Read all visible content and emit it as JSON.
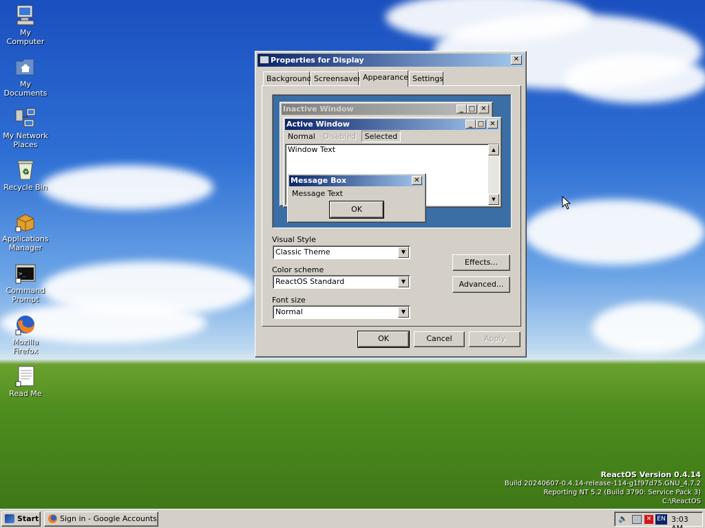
{
  "desktop": {
    "icons": [
      {
        "label1": "My",
        "label2": "Computer"
      },
      {
        "label1": "My",
        "label2": "Documents"
      },
      {
        "label1": "My Network",
        "label2": "Places"
      },
      {
        "label1": "Recycle Bin",
        "label2": ""
      },
      {
        "label1": "Applications",
        "label2": "Manager"
      },
      {
        "label1": "Command",
        "label2": "Prompt"
      },
      {
        "label1": "Mozilla",
        "label2": "Firefox"
      },
      {
        "label1": "Read Me",
        "label2": ""
      }
    ],
    "watermark": {
      "version": "ReactOS Version 0.4.14",
      "build": "Build 20240607-0.4.14-release-114-g1f97d75.GNU_4.7.2",
      "reporting": "Reporting NT 5.2 (Build 3790: Service Pack 3)",
      "path": "C:\\ReactOS"
    }
  },
  "dialog": {
    "title": "Properties for Display",
    "close_glyph": "✕",
    "tabs": [
      "Background",
      "Screensaver",
      "Appearance",
      "Settings"
    ],
    "active_tab": "Appearance",
    "preview": {
      "inactive_title": "Inactive Window",
      "active_title": "Active Window",
      "menu": [
        "Normal",
        "Disabled",
        "Selected"
      ],
      "window_text": "Window Text",
      "msgbox_title": "Message Box",
      "msgbox_text": "Message Text",
      "msgbox_ok": "OK"
    },
    "visual_style_label": "Visual Style",
    "visual_style_value": "Classic Theme",
    "color_scheme_label": "Color scheme",
    "color_scheme_value": "ReactOS Standard",
    "font_size_label": "Font size",
    "font_size_value": "Normal",
    "effects_button": "Effects...",
    "advanced_button": "Advanced...",
    "ok_button": "OK",
    "cancel_button": "Cancel",
    "apply_button": "Apply"
  },
  "taskbar": {
    "start_label": "Start",
    "task_label": "Sign in - Google Accounts - ...",
    "lang": "EN",
    "clock": "3:03 AM"
  },
  "colors": {
    "active_title_start": "#0a246a",
    "active_title_end": "#a6caf0",
    "inactive_title_start": "#808080",
    "inactive_title_end": "#c0c0c0",
    "preview_desktop": "#3a6ea5",
    "face": "#d4d0c8"
  }
}
